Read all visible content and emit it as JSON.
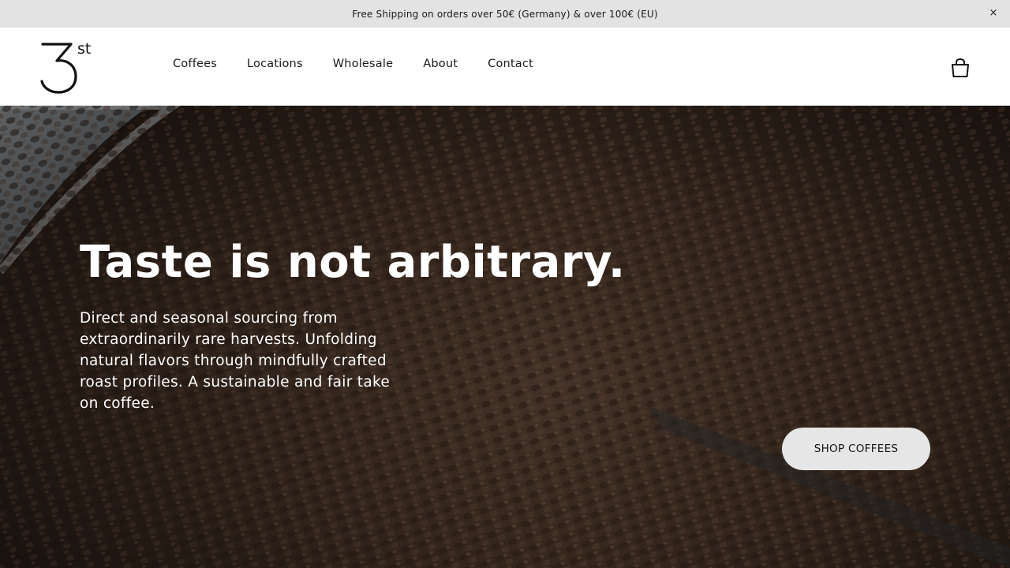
{
  "announcement": {
    "text": "Free Shipping on orders over 50€ (Germany) & over 100€ (EU)",
    "close_glyph": "×"
  },
  "header": {
    "logo": {
      "number": "3",
      "suffix": "st"
    },
    "nav": [
      {
        "label": "Coffees"
      },
      {
        "label": "Locations"
      },
      {
        "label": "Wholesale"
      },
      {
        "label": "About"
      },
      {
        "label": "Contact"
      }
    ],
    "cart_icon": "shopping-bag-icon"
  },
  "hero": {
    "title": "Taste is not arbitrary.",
    "description": "Direct and seasonal sourcing from extraordinarily rare harvests. Unfolding natural flavors through mindfully crafted roast profiles. A sustainable and fair take on coffee.",
    "cta_label": "SHOP COFFEES",
    "image": "coffee-beans-roaster"
  },
  "colors": {
    "announcement_bg": "#e3e3e3",
    "cta_bg": "#e6e6e6",
    "hero_text": "#ffffff"
  }
}
